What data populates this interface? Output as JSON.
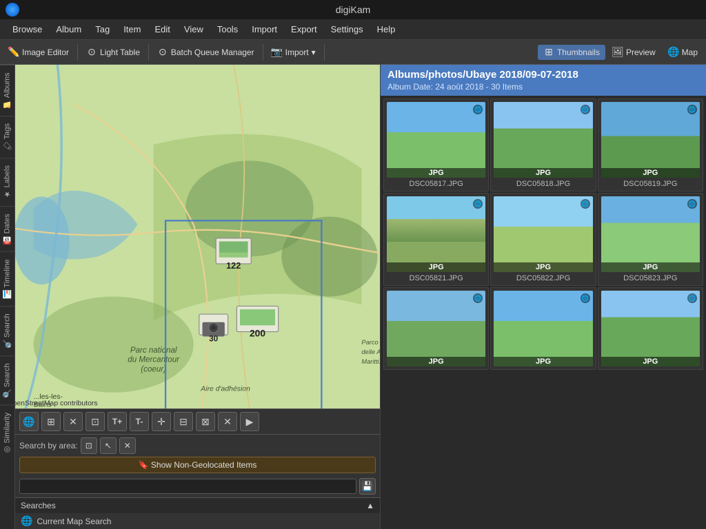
{
  "titlebar": {
    "title": "digiKam"
  },
  "menubar": {
    "items": [
      "Browse",
      "Album",
      "Tag",
      "Item",
      "Edit",
      "View",
      "Tools",
      "Import",
      "Export",
      "Settings",
      "Help"
    ]
  },
  "toolbar": {
    "image_editor": "Image Editor",
    "light_table": "Light Table",
    "batch_queue": "Batch Queue Manager",
    "import": "Import",
    "thumbnails": "Thumbnails",
    "preview": "Preview",
    "map": "Map"
  },
  "sidebar": {
    "tabs": [
      "Albums",
      "Tags",
      "Labels",
      "Dates",
      "Timeline",
      "Search",
      "Search",
      "Similarity"
    ]
  },
  "map": {
    "attribution": "© OpenStreetMap contributors",
    "cluster_122": "122",
    "cluster_200": "200",
    "cluster_30": "30"
  },
  "map_controls": {
    "buttons": [
      "🌐",
      "⊞",
      "✕",
      "⊡",
      "T+",
      "T-",
      "✛",
      "⊟",
      "⊠",
      "✕",
      "▶"
    ]
  },
  "search_area": {
    "label": "Search by area:",
    "buttons": [
      "⊡",
      "↖",
      "✕"
    ]
  },
  "show_non_geo": {
    "label": "🔖 Show Non-Geolocated Items"
  },
  "searches": {
    "header": "Searches",
    "current": "Current Map Search",
    "collapse_icon": "▲"
  },
  "album": {
    "path": "Albums/photos/Ubaye 2018/09-07-2018",
    "date_info": "Album Date: 24 août 2018 - 30 Items"
  },
  "thumbnails": [
    {
      "name": "DSC05817.JPG",
      "label": "JPG",
      "style": "sky-green"
    },
    {
      "name": "DSC05818.JPG",
      "label": "JPG",
      "style": "sky-green2"
    },
    {
      "name": "DSC05819.JPG",
      "label": "JPG",
      "style": "sky-green3"
    },
    {
      "name": "DSC05821.JPG",
      "label": "JPG",
      "style": "sky-mountain"
    },
    {
      "name": "DSC05822.JPG",
      "label": "JPG",
      "style": "sky-field"
    },
    {
      "name": "DSC05823.JPG",
      "label": "JPG",
      "style": "sky-alpine"
    },
    {
      "name": "",
      "label": "JPG",
      "style": "partial-thumb"
    },
    {
      "name": "",
      "label": "JPG",
      "style": "sky-green"
    },
    {
      "name": "",
      "label": "JPG",
      "style": "sky-green2"
    }
  ],
  "colors": {
    "accent": "#4a7abf",
    "toolbar_active": "#4a6fa5"
  }
}
